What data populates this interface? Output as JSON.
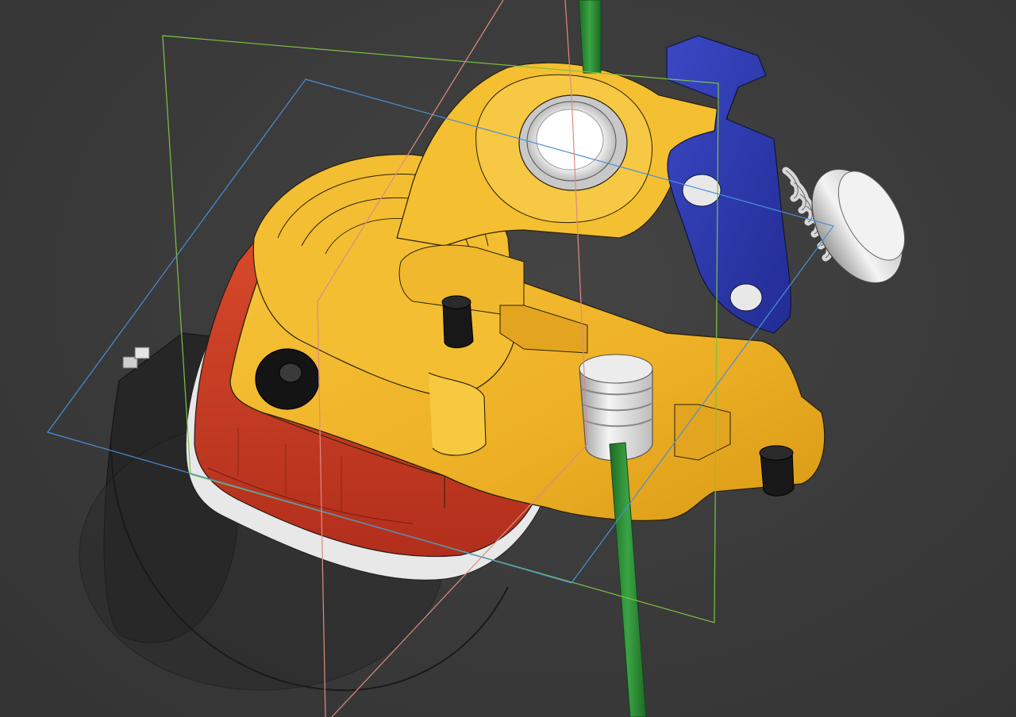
{
  "viewport": {
    "background": "#3b3b3b"
  },
  "scene": {
    "parts": [
      {
        "name": "extruder-body",
        "color": "#f0b428"
      },
      {
        "name": "motor-mount",
        "color": "#cc3a22"
      },
      {
        "name": "stepper-motor",
        "color": "#1f1f1f"
      },
      {
        "name": "idler-lever",
        "color": "#2b38a8"
      },
      {
        "name": "filament",
        "color": "#2f8a36"
      },
      {
        "name": "tension-spring",
        "color": "#e6e6e6"
      },
      {
        "name": "pushfit-fitting",
        "color": "#dcdcdc"
      },
      {
        "name": "set-screw",
        "color": "#151515"
      }
    ],
    "planes": [
      {
        "name": "xy-plane",
        "color": "#7ec242"
      },
      {
        "name": "xz-plane",
        "color": "#4a8fd6"
      },
      {
        "name": "yz-plane",
        "color": "#e08a84"
      }
    ]
  }
}
